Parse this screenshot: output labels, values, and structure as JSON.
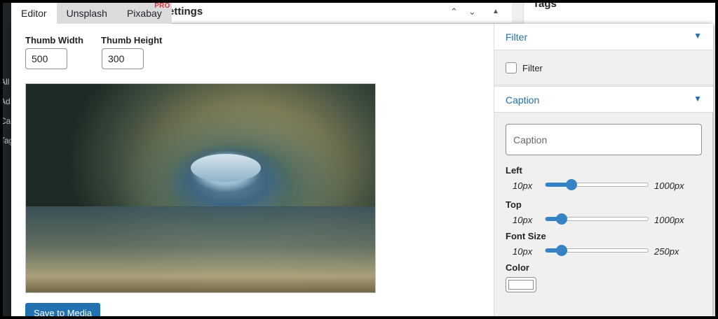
{
  "background": {
    "panel_title": "Settings",
    "sidebar_panel_title": "Tags",
    "menu_fragments": [
      "All",
      "Ad",
      "Ca",
      "Tag"
    ]
  },
  "tabs": [
    {
      "label": "Editor",
      "active": true
    },
    {
      "label": "Unsplash",
      "active": false
    },
    {
      "label": "Pixabay",
      "active": false,
      "badge": "PRO"
    }
  ],
  "thumb": {
    "width_label": "Thumb Width",
    "width_value": "500",
    "height_label": "Thumb Height",
    "height_value": "300"
  },
  "preview": {
    "icon": "image-preview"
  },
  "save_button": "Save to Media",
  "sidebar": {
    "filter_section": {
      "title": "Filter",
      "arrow": "▼",
      "checkbox_label": "Filter",
      "checked": false
    },
    "caption_section": {
      "title": "Caption",
      "arrow": "▼",
      "caption_placeholder": "Caption"
    },
    "sliders": [
      {
        "label": "Left",
        "min_label": "10px",
        "max_label": "1000px",
        "level_fraction": 0.25
      },
      {
        "label": "Top",
        "min_label": "10px",
        "max_label": "1000px",
        "level_fraction": 0.16
      },
      {
        "label": "Font Size",
        "min_label": "10px",
        "max_label": "250px",
        "level_fraction": 0.16
      }
    ],
    "color_label": "Color",
    "color_value": "#ffffff"
  },
  "colors": {
    "accent": "#2271b1",
    "slider": "#3582c4",
    "pro_badge": "#d63638"
  }
}
